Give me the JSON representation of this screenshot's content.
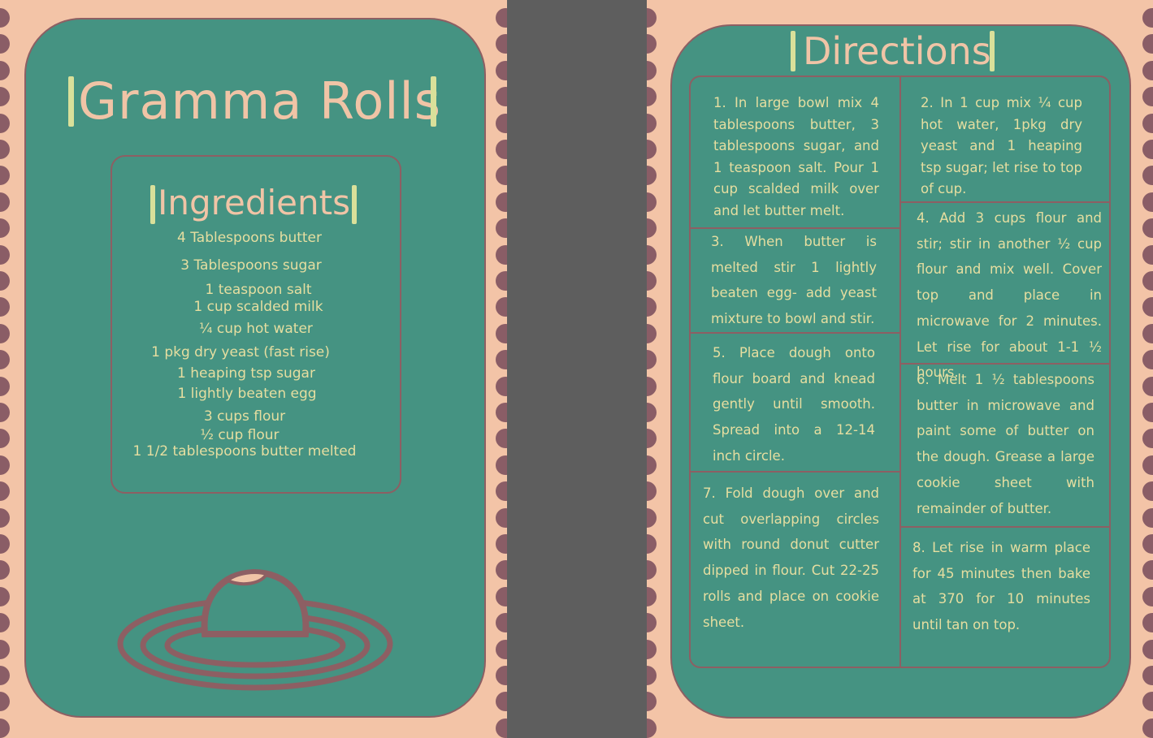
{
  "left_page": {
    "title": "Gramma Rolls",
    "ingredients_heading": "Ingredients",
    "ingredients": [
      "4 Tablespoons butter",
      "3 Tablespoons sugar",
      "1 teaspoon salt",
      "1 cup scalded milk",
      "¼ cup hot water",
      "1 pkg dry yeast (fast rise)",
      "1 heaping tsp sugar",
      "1 lightly beaten egg",
      "3 cups flour",
      "½ cup flour",
      "1 1/2 tablespoons butter melted"
    ]
  },
  "right_page": {
    "heading": "Directions",
    "steps": [
      "1. In large bowl mix 4 tablespoons butter, 3 tablespoons sugar, and 1 teaspoon salt. Pour 1 cup scalded milk over and let butter melt.",
      "2. In 1 cup mix ¼ cup hot water, 1pkg dry yeast and 1 heaping tsp sugar; let rise to top of cup.",
      "3. When butter is melted stir 1 lightly beaten egg- add yeast mixture to bowl and stir.",
      "4. Add 3 cups flour and stir; stir in another ½ cup flour and mix well. Cover top and place in microwave for 2 minutes. Let rise for about 1-1 ½ hours.",
      "5. Place dough onto flour board and knead gently until smooth. Spread into a 12-14 inch circle.",
      "6. Melt 1 ½ tablespoons butter in microwave and paint some of butter on the dough. Grease a large cookie sheet with remainder of butter.",
      "7. Fold dough over and cut overlapping circles with round donut cutter dipped in flour. Cut 22-25 rolls and place on cookie sheet.",
      "8. Let rise in warm place for 45 minutes then bake at 370 for 10 minutes until tan on top."
    ]
  },
  "colors": {
    "page_background": "#f3c4a7",
    "card_green": "#459382",
    "border_mauve": "#8d5f63",
    "dot_mauve": "#8a5d66",
    "spine_gray": "#5e5e5e",
    "title_peach": "#f0c4a6",
    "text_cream": "#e6dea0",
    "accent_bar": "#d9e09a"
  },
  "icons": {
    "illustration": "roll-on-plate-icon"
  }
}
